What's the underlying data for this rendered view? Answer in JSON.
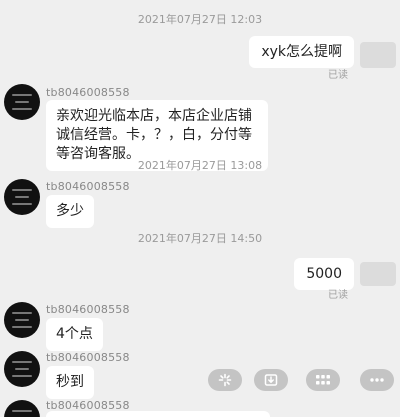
{
  "timestamps": [
    "2021年07月27日 12:03",
    "2021年07月27日 13:08",
    "2021年07月27日 14:50"
  ],
  "messages": [
    {
      "side": "right",
      "text": "xyk怎么提啊",
      "status": "已读"
    },
    {
      "side": "left",
      "sender": "tb8046008558",
      "text_lines": [
        "亲欢迎光临本店，本店企业店铺",
        "诚信经营。卡，？，白，分付等",
        "等咨询客服。"
      ]
    },
    {
      "side": "left",
      "sender": "tb8046008558",
      "text": "多少"
    },
    {
      "side": "right",
      "text": "5000",
      "status": "已读"
    },
    {
      "side": "left",
      "sender": "tb8046008558",
      "text": "4个点"
    },
    {
      "side": "left",
      "sender": "tb8046008558",
      "text": "秒到"
    },
    {
      "side": "left",
      "sender": "tb8046008558",
      "text": ""
    }
  ],
  "toolbar_icons": [
    "sparkle-icon",
    "download-tray-icon",
    "grid-menu-icon",
    "more-dots-icon"
  ]
}
